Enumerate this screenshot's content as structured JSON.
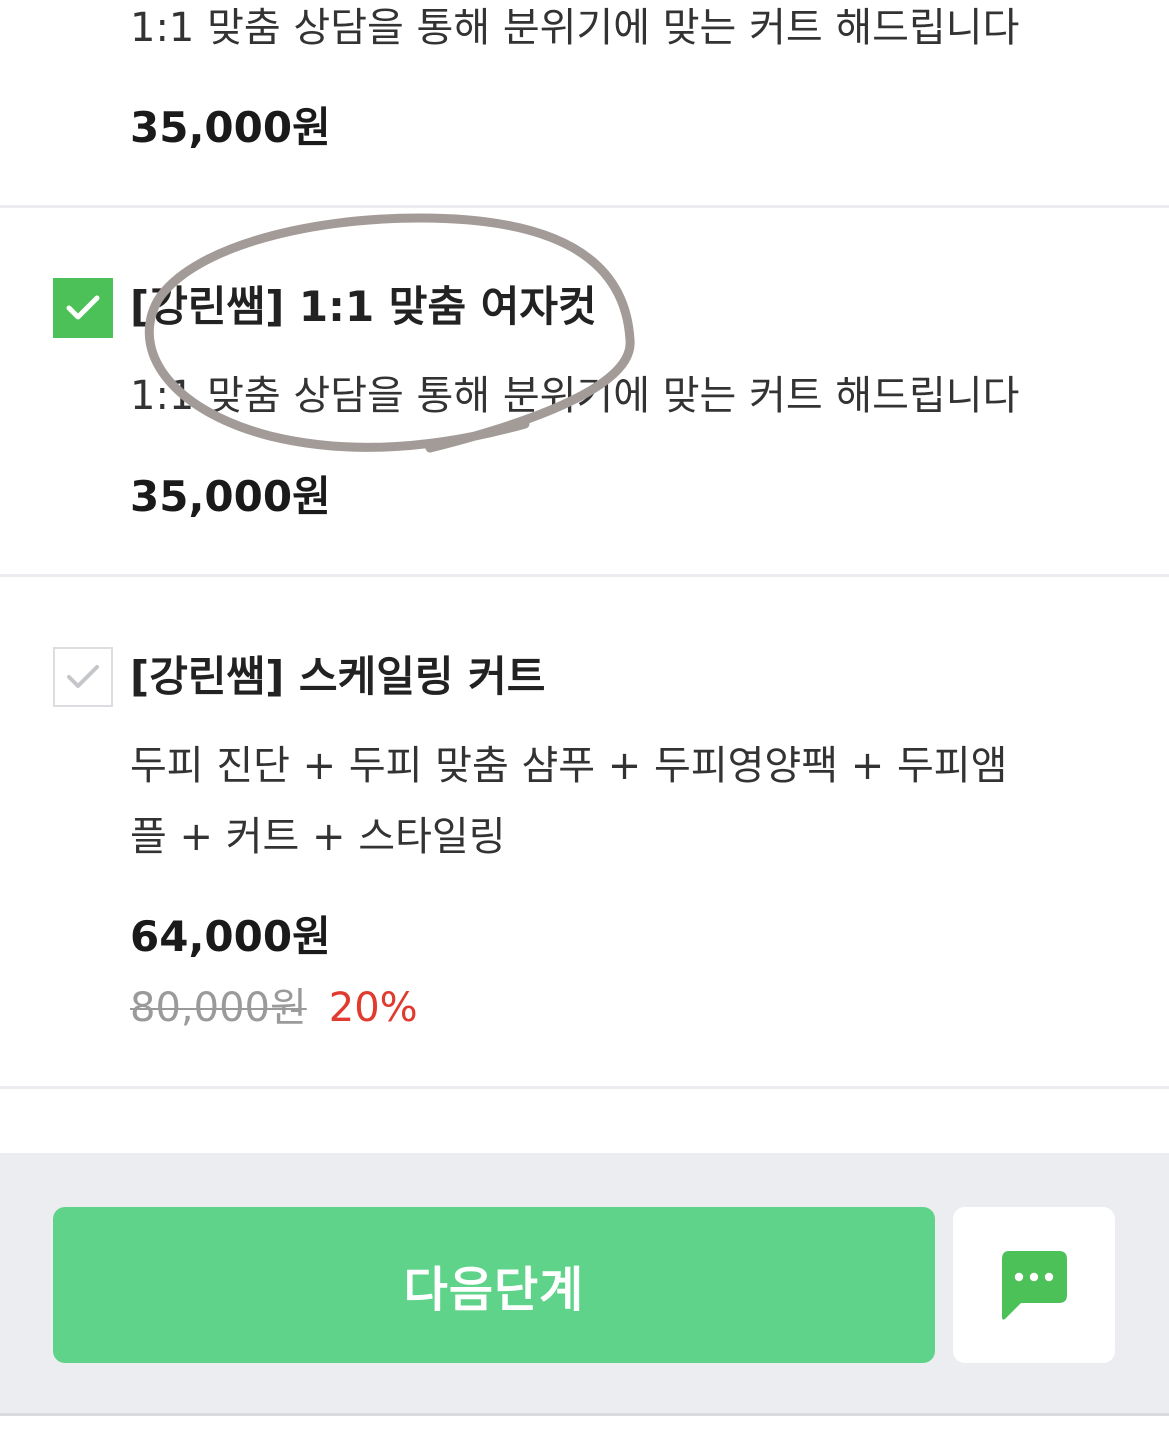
{
  "items": [
    {
      "description": "1:1 맞춤 상담을 통해 분위기에 맞는 커트 해드립니다",
      "price": "35,000원"
    },
    {
      "checked": true,
      "title": "[강린쌤] 1:1 맞춤 여자컷",
      "description": "1:1 맞춤 상담을 통해 분위기에 맞는 커트 해드립니다",
      "price": "35,000원"
    },
    {
      "checked": false,
      "title": "[강린쌤] 스케일링 커트",
      "description_line1": "두피 진단 + 두피 맞춤 샴푸 + 두피영양팩 + 두피앰",
      "description_line2": "플 + 커트 + 스타일링",
      "price": "64,000원",
      "original_price": "80,000원",
      "discount": "20%"
    }
  ],
  "bottom_bar": {
    "next_label": "다음단계",
    "chat_icon": "chat-bubble-icon"
  },
  "colors": {
    "check_green": "#4cc157",
    "button_green": "#5fd38a",
    "discount_red": "#e03b2e",
    "annotation_gray": "#a39b98",
    "chat_icon_green": "#4cc157"
  }
}
